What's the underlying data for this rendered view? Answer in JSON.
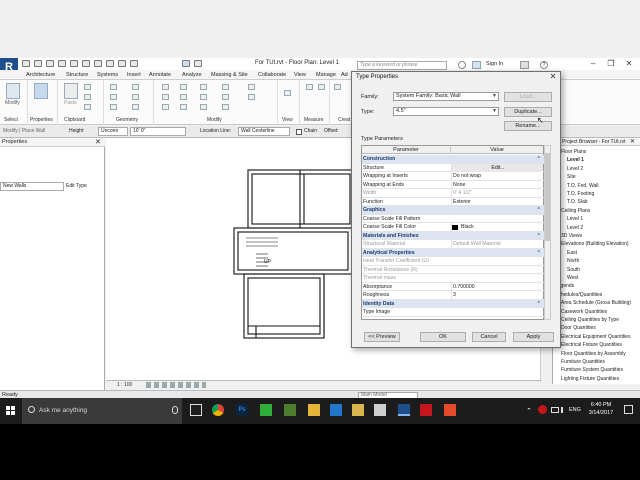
{
  "app": {
    "logo": "R",
    "file_title": "For TUt.rvt - Floor Plan: Level 1",
    "search_placeholder": "Type a keyword or phrase",
    "sign_in": "Sign In"
  },
  "ribbon": {
    "tabs": [
      "Architecture",
      "Structure",
      "Systems",
      "Insert",
      "Annotate",
      "Analyze",
      "Massing & Site",
      "Collaborate",
      "View",
      "Manage",
      "Ad"
    ],
    "active_tab": "Modify",
    "groups": [
      "Select",
      "Properties",
      "Clipboard",
      "Geometry",
      "Modify",
      "View",
      "Measure",
      "Creat"
    ],
    "modify_label": "Modify",
    "paste_label": "Paste"
  },
  "options_bar": {
    "context": "Modify | Place Wall",
    "height_label": "Height",
    "height_value": "Unconn",
    "height_num": "10'  0\"",
    "location_label": "Location Line:",
    "location_value": "Wall Centerline",
    "chain_label": "Chain",
    "offset_label": "Offset:"
  },
  "properties": {
    "title": "Properties",
    "type_selector": "New Walls",
    "edit_type": "Edit Type"
  },
  "view": {
    "scale": "1 : 100",
    "stair_label": "UP"
  },
  "browser": {
    "title": "Project Browser - For TUt.rvt",
    "items": [
      {
        "label": "Floor Plans",
        "indent": 1
      },
      {
        "label": "Level 1",
        "indent": 2,
        "bold": true
      },
      {
        "label": "Level 2",
        "indent": 2
      },
      {
        "label": "Site",
        "indent": 2
      },
      {
        "label": "T.O. Fnd. Wall",
        "indent": 2
      },
      {
        "label": "T.O. Footing",
        "indent": 2
      },
      {
        "label": "T.O. Slab",
        "indent": 2
      },
      {
        "label": "Ceiling Plans",
        "indent": 1
      },
      {
        "label": "Level 1",
        "indent": 2
      },
      {
        "label": "Level 2",
        "indent": 2
      },
      {
        "label": "3D Views",
        "indent": 1
      },
      {
        "label": "Elevations (Building Elevation)",
        "indent": 1
      },
      {
        "label": "East",
        "indent": 2
      },
      {
        "label": "North",
        "indent": 2
      },
      {
        "label": "South",
        "indent": 2
      },
      {
        "label": "West",
        "indent": 2
      },
      {
        "label": "Legends",
        "indent": 0
      },
      {
        "label": "Schedules/Quantities",
        "indent": 0
      },
      {
        "label": "Area Schedule (Gross Building)",
        "indent": 1
      },
      {
        "label": "Casework Quantities",
        "indent": 1
      },
      {
        "label": "Ceiling Quantities by Type",
        "indent": 1
      },
      {
        "label": "Door Quantities",
        "indent": 1
      },
      {
        "label": "Electrical Equipment Quantities",
        "indent": 1
      },
      {
        "label": "Electrical Fixture Quantities",
        "indent": 1
      },
      {
        "label": "Floor Quantities by Assembly",
        "indent": 1
      },
      {
        "label": "Furniture Quantities",
        "indent": 1
      },
      {
        "label": "Furniture System Quantities",
        "indent": 1
      },
      {
        "label": "Lighting Fixture Quantities",
        "indent": 1
      }
    ]
  },
  "status": {
    "text": "Ready",
    "model": "Main Model"
  },
  "dialog": {
    "title": "Type Properties",
    "family_label": "Family:",
    "family_value": "System Family: Basic Wall",
    "type_label": "Type:",
    "type_value": "4.5\"",
    "load_button": "Load...",
    "duplicate_button": "Duplicate...",
    "rename_button": "Rename...",
    "params_label": "Type Parameters",
    "col_parameter": "Parameter",
    "col_value": "Value",
    "rows": [
      {
        "kind": "cat",
        "p": "Construction",
        "v": ""
      },
      {
        "kind": "row",
        "p": "Structure",
        "v": "Edit..."
      },
      {
        "kind": "row",
        "p": "Wrapping at Inserts",
        "v": "Do not wrap"
      },
      {
        "kind": "row",
        "p": "Wrapping at Ends",
        "v": "None"
      },
      {
        "kind": "dim",
        "p": "Width",
        "v": "0'  4 1/2\""
      },
      {
        "kind": "row",
        "p": "Function",
        "v": "Exterior"
      },
      {
        "kind": "cat",
        "p": "Graphics",
        "v": ""
      },
      {
        "kind": "row",
        "p": "Coarse Scale Fill Pattern",
        "v": ""
      },
      {
        "kind": "row",
        "p": "Coarse Scale Fill Color",
        "v": "Black"
      },
      {
        "kind": "cat",
        "p": "Materials and Finishes",
        "v": ""
      },
      {
        "kind": "dim",
        "p": "Structural Material",
        "v": "Default Wall Material"
      },
      {
        "kind": "cat",
        "p": "Analytical Properties",
        "v": ""
      },
      {
        "kind": "dim",
        "p": "Heat Transfer Coefficient (U)",
        "v": ""
      },
      {
        "kind": "dim",
        "p": "Thermal Resistance (R)",
        "v": ""
      },
      {
        "kind": "dim",
        "p": "Thermal mass",
        "v": ""
      },
      {
        "kind": "row",
        "p": "Absorptance",
        "v": "0.700000"
      },
      {
        "kind": "row",
        "p": "Roughness",
        "v": "3"
      },
      {
        "kind": "cat",
        "p": "Identity Data",
        "v": ""
      },
      {
        "kind": "row",
        "p": "Type Image",
        "v": ""
      }
    ],
    "preview_button": "<< Preview",
    "ok_button": "OK",
    "cancel_button": "Cancel",
    "apply_button": "Apply"
  },
  "taskbar": {
    "search_text": "Ask me anything",
    "lang": "ENG",
    "time": "6:40 PM",
    "date": "3/14/2017",
    "colors": {
      "bg": "#1c1c1c",
      "accent": "#1e6fd9"
    }
  }
}
